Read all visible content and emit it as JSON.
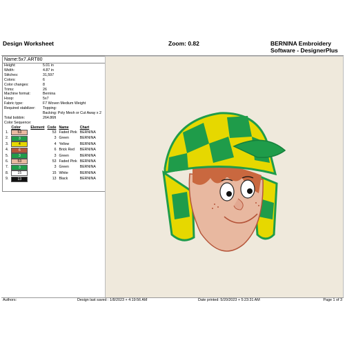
{
  "header": {
    "title": "Design Worksheet",
    "zoom": "Zoom:  0.82",
    "software_line1": "BERNINA Embroidery",
    "software_line2": "Software - DesignerPlus"
  },
  "info": {
    "name": "Name:5x7.ART80",
    "rows": [
      {
        "k": "Height:",
        "v": "5.01 in"
      },
      {
        "k": "Width:",
        "v": "4.87 in"
      },
      {
        "k": "Stitches:",
        "v": "31,597"
      },
      {
        "k": "Colors:",
        "v": "6"
      },
      {
        "k": "Color changes:",
        "v": "8"
      },
      {
        "k": "Trims:",
        "v": "26"
      },
      {
        "k": "Machine format:",
        "v": "Bernina"
      },
      {
        "k": "Hoop:",
        "v": "5x7"
      },
      {
        "k": "Fabric type:",
        "v": "F7 Woven Medium Weight"
      },
      {
        "k": "Required stabilizer:",
        "v": "Topping:"
      },
      {
        "k": "",
        "v": "Backing: Poly Mesh or Cut Away x 2"
      },
      {
        "k": "Total bobbin:",
        "v": "264.86ft"
      }
    ],
    "color_sequence_label": "Color Sequence:",
    "columns": {
      "color": "Color",
      "element": "Element",
      "code": "Code",
      "name": "Name",
      "chart": "Chart"
    },
    "colors": [
      {
        "idx": "1.",
        "code": "53",
        "name": "Faded Pink",
        "chart": "BERNINA",
        "hex": "#e8b8a0",
        "fg": "#000"
      },
      {
        "idx": "2.",
        "code": "3",
        "name": "Green",
        "chart": "BERNINA",
        "hex": "#1f9c4a",
        "fg": "#fff"
      },
      {
        "idx": "3.",
        "code": "4",
        "name": "Yellow",
        "chart": "BERNINA",
        "hex": "#e6d800",
        "fg": "#000"
      },
      {
        "idx": "4.",
        "code": "6",
        "name": "Brick Red",
        "chart": "BERNINA",
        "hex": "#b5553a",
        "fg": "#fff"
      },
      {
        "idx": "5.",
        "code": "3",
        "name": "Green",
        "chart": "BERNINA",
        "hex": "#1f9c4a",
        "fg": "#fff"
      },
      {
        "idx": "6.",
        "code": "53",
        "name": "Faded Pink",
        "chart": "BERNINA",
        "hex": "#e8b8a0",
        "fg": "#000"
      },
      {
        "idx": "7.",
        "code": "3",
        "name": "Green",
        "chart": "BERNINA",
        "hex": "#1f9c4a",
        "fg": "#fff"
      },
      {
        "idx": "8.",
        "code": "15",
        "name": "White",
        "chart": "BERNINA",
        "hex": "#ffffff",
        "fg": "#000"
      },
      {
        "idx": "9.",
        "code": "13",
        "name": "Black",
        "chart": "BERNINA",
        "hex": "#111111",
        "fg": "#fff"
      }
    ]
  },
  "footer": {
    "authors": "Authors:",
    "saved": "Design last saved : 1/8/2023 + 4:19:56 AM",
    "printed": "Date printed: 5/20/2023 + 5:23:31 AM",
    "page": "Page 1 of 3"
  }
}
